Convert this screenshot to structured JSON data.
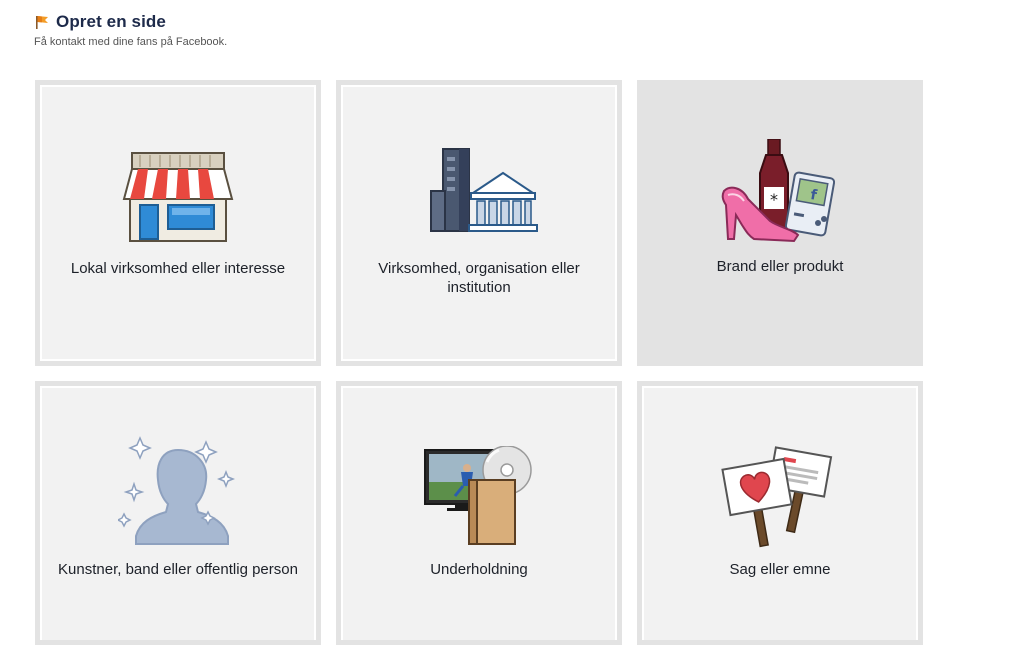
{
  "header": {
    "title": "Opret en side",
    "subtitle": "Få kontakt med dine fans på Facebook.",
    "icon": "flag-icon"
  },
  "tiles": [
    {
      "label": "Lokal virksomhed eller interesse",
      "icon": "storefront-icon"
    },
    {
      "label": "Virksomhed, organisation eller institution",
      "icon": "buildings-icon"
    },
    {
      "label": "Brand eller produkt",
      "icon": "products-icon"
    },
    {
      "label": "Kunstner, band eller offentlig person",
      "icon": "person-silhouette-icon"
    },
    {
      "label": "Underholdning",
      "icon": "entertainment-icon"
    },
    {
      "label": "Sag eller emne",
      "icon": "protest-signs-icon"
    }
  ],
  "colors": {
    "tile_border": "#e3e3e3",
    "tile_bg": "#f2f2f2",
    "title": "#1d2a4a"
  }
}
